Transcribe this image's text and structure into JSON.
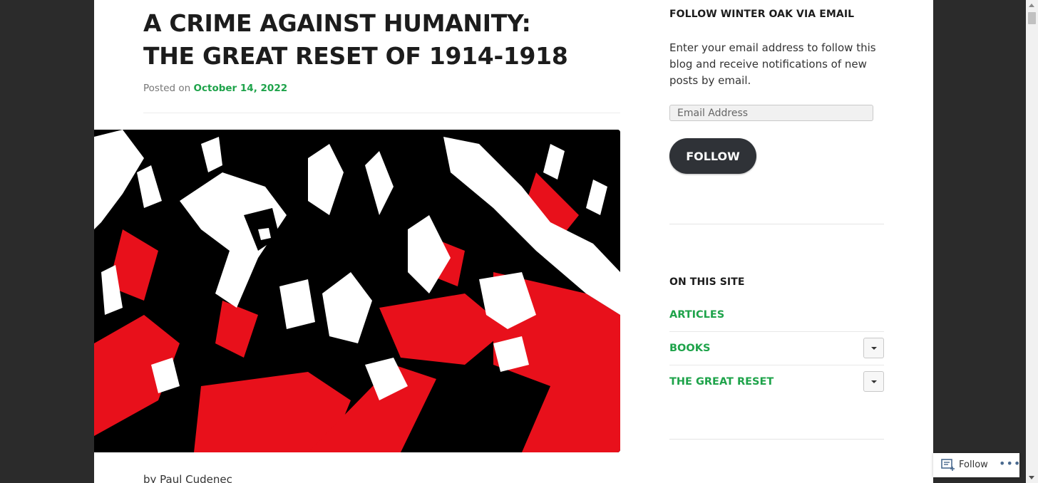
{
  "post": {
    "title": "A CRIME AGAINST HUMANITY: THE GREAT RESET OF 1914-1918",
    "posted_prefix": "Posted on",
    "date": "October 14, 2022",
    "byline": "by Paul Cudenec"
  },
  "sidebar": {
    "follow_widget": {
      "title": "FOLLOW WINTER OAK VIA EMAIL",
      "text": "Enter your email address to follow this blog and receive notifications of new posts by email.",
      "email_placeholder": "Email Address",
      "button_label": "FOLLOW"
    },
    "site_menu": {
      "title": "ON THIS SITE",
      "items": [
        {
          "label": "ARTICLES",
          "has_submenu": false
        },
        {
          "label": "BOOKS",
          "has_submenu": true
        },
        {
          "label": "THE GREAT RESET",
          "has_submenu": true
        }
      ]
    }
  },
  "follow_bar": {
    "label": "Follow",
    "more": "•••"
  },
  "colors": {
    "accent": "#1ea34a",
    "title": "#1c1c1c",
    "button": "#2f3237",
    "frame": "#2b2b2b",
    "art_red": "#e8101b"
  },
  "icons": [
    "follow-reader-icon",
    "more-options-icon",
    "dropdown-caret-icon"
  ]
}
